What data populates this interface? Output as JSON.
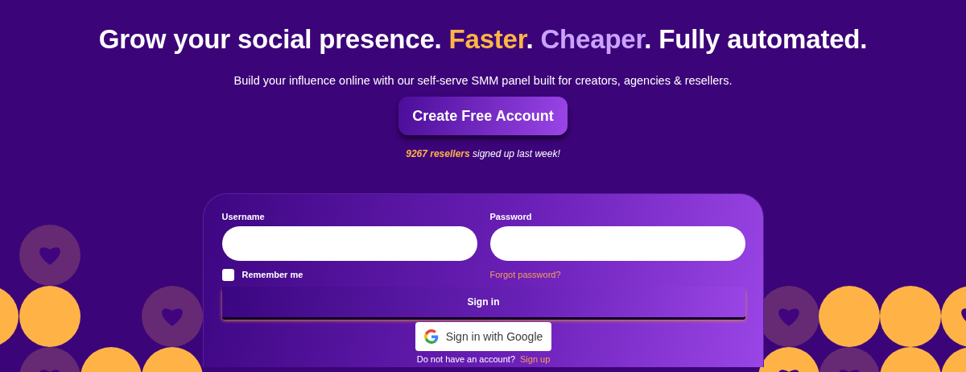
{
  "hero": {
    "headline": [
      {
        "text": "Grow your social presence. ",
        "color": "#ffffff"
      },
      {
        "text": "Faster",
        "color": "#ffb545"
      },
      {
        "text": ". ",
        "color": "#ffffff"
      },
      {
        "text": "Cheaper",
        "color": "#c9a3ff"
      },
      {
        "text": ". Fully automated.",
        "color": "#ffffff"
      }
    ],
    "subtitle": "Build your influence online with our self-serve SMM panel built for creators, agencies & resellers.",
    "cta": "Create Free Account",
    "social_proof": "**9267 resellers** signed up last week!"
  },
  "login": {
    "username_label": "Username",
    "password_label": "Password",
    "remember": {
      "label": "Remember me",
      "checked": false
    },
    "forgot": "Forgot password?",
    "sign_in": "Sign in",
    "google": "Sign in with Google",
    "no_account": "Do not have an account?",
    "sign_up": "Sign up"
  }
}
